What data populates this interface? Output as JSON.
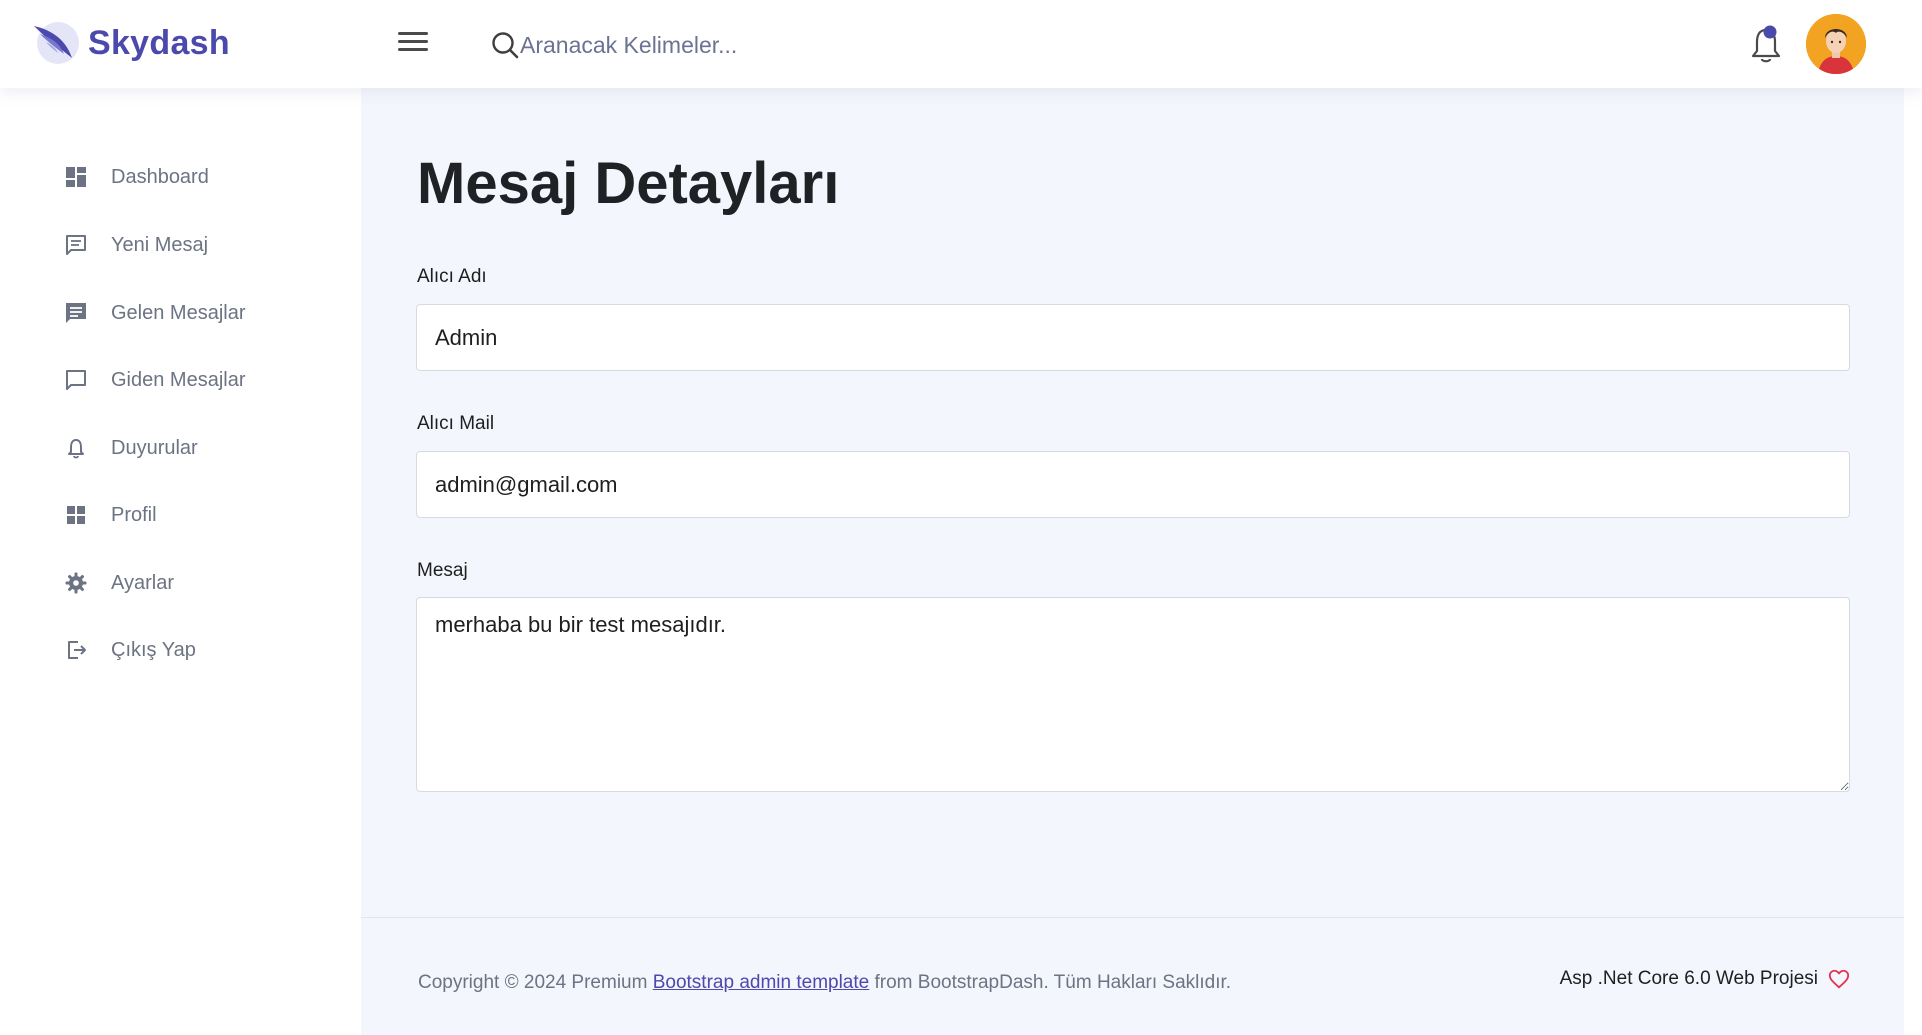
{
  "brand": {
    "name": "Skydash",
    "color": "#4b49ac"
  },
  "search": {
    "placeholder": "Aranacak Kelimeler..."
  },
  "header": {
    "notification_icon": "bell-icon",
    "avatar_icon": "user-avatar"
  },
  "sidebar": {
    "items": [
      {
        "label": "Dashboard",
        "icon": "dashboard-icon"
      },
      {
        "label": "Yeni Mesaj",
        "icon": "message-outline-icon"
      },
      {
        "label": "Gelen Mesajlar",
        "icon": "message-filled-icon"
      },
      {
        "label": "Giden Mesajlar",
        "icon": "chat-bubble-icon"
      },
      {
        "label": "Duyurular",
        "icon": "bell-icon"
      },
      {
        "label": "Profil",
        "icon": "grid-icon"
      },
      {
        "label": "Ayarlar",
        "icon": "gear-icon"
      },
      {
        "label": "Çıkış Yap",
        "icon": "logout-icon"
      }
    ]
  },
  "main": {
    "title": "Mesaj Detayları",
    "fields": {
      "recipient_name": {
        "label": "Alıcı Adı",
        "value": "Admin"
      },
      "recipient_mail": {
        "label": "Alıcı Mail",
        "value": "admin@gmail.com"
      },
      "message": {
        "label": "Mesaj",
        "value": "merhaba bu bir test mesajıdır."
      }
    }
  },
  "footer": {
    "copyright_prefix": "Copyright © 2024 Premium ",
    "link_text": "Bootstrap admin template",
    "copyright_suffix": " from BootstrapDash. Tüm Hakları Saklıdır.",
    "project_text": "Asp .Net Core 6.0 Web Projesi",
    "heart_icon": "heart-icon"
  },
  "colors": {
    "accent": "#4b49ac",
    "main_background": "#f4f6fd",
    "sidebar_text": "#6c7383",
    "heart": "#e5334b"
  }
}
